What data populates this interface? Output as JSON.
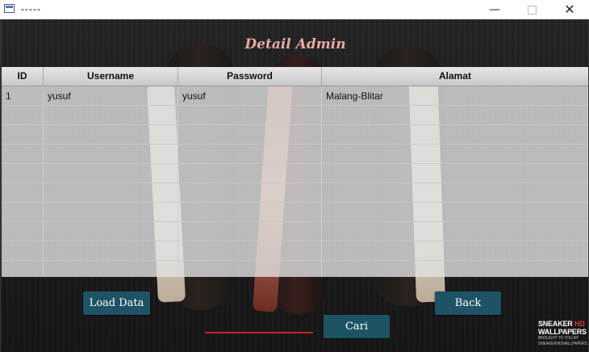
{
  "window": {
    "title": "-----",
    "minimize": "—",
    "close": "✕"
  },
  "header": {
    "title": "Detail Admin"
  },
  "table": {
    "columns": [
      "ID",
      "Username",
      "Password",
      "Alamat"
    ],
    "rows": [
      [
        "1",
        "yusuf",
        "yusuf",
        "Malang-Blitar"
      ],
      [
        "",
        "",
        "",
        ""
      ],
      [
        "",
        "",
        "",
        ""
      ],
      [
        "",
        "",
        "",
        ""
      ],
      [
        "",
        "",
        "",
        ""
      ],
      [
        "",
        "",
        "",
        ""
      ],
      [
        "",
        "",
        "",
        ""
      ],
      [
        "",
        "",
        "",
        ""
      ],
      [
        "",
        "",
        "",
        ""
      ],
      [
        "",
        "",
        "",
        ""
      ]
    ]
  },
  "buttons": {
    "load": "Load Data",
    "back": "Back",
    "cari": "Cari"
  },
  "search": {
    "value": "",
    "placeholder": ""
  },
  "watermark": {
    "line1": "SNEAKER",
    "hd": "HD",
    "line2": "WALLPAPERS",
    "line3": "BROUGHT TO YOU BY SNEAKERHDWALLPAPERS"
  },
  "colors": {
    "button": "#1d5364",
    "title": "#e8a9a2",
    "search_underline": "#c92121"
  }
}
